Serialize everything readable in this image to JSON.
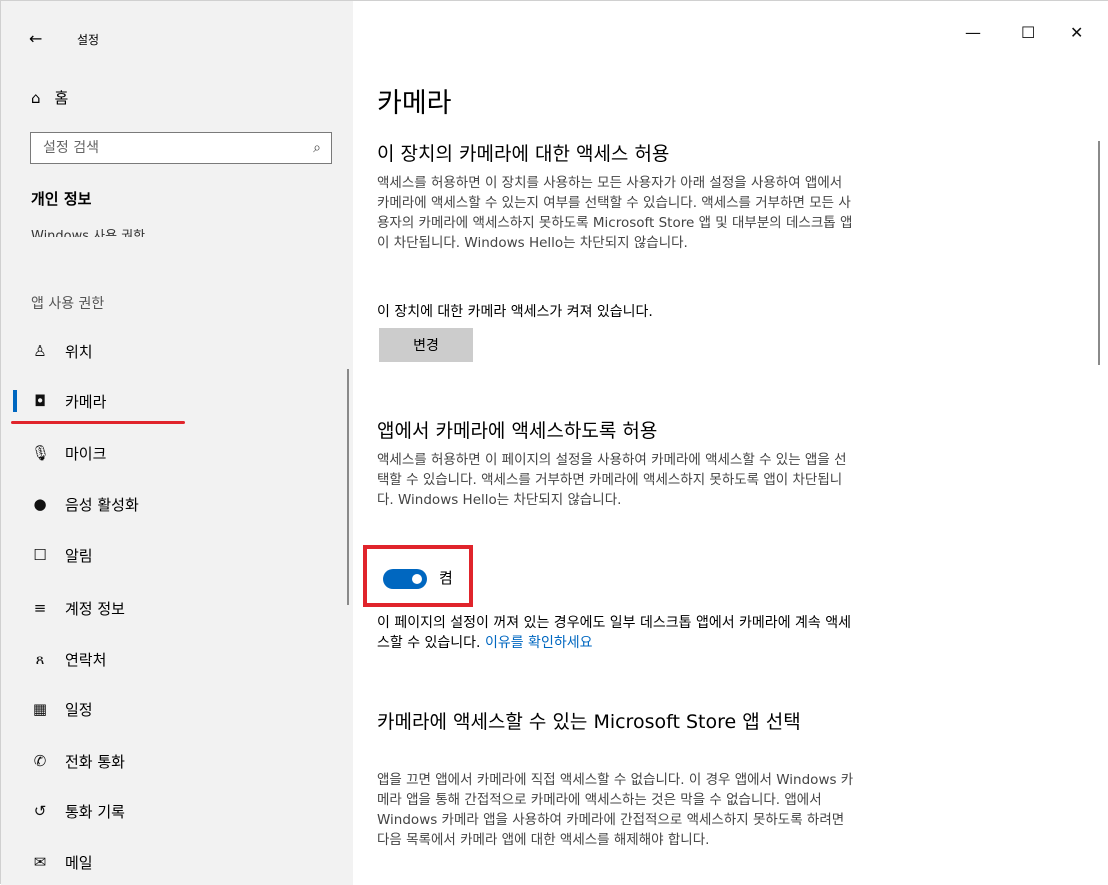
{
  "window": {
    "title": "설정",
    "back_glyph": "←",
    "minimize_glyph": "—",
    "maximize_glyph": "☐",
    "close_glyph": "✕"
  },
  "sidebar": {
    "home_icon": "⌂",
    "home_label": "홈",
    "search_placeholder": "설정 검색",
    "search_icon": "⌕",
    "section_title": "개인 정보",
    "clipped_item": "Windows 사용 권한",
    "group_label": "앱 사용 권한",
    "items": [
      {
        "icon": "♙",
        "label": "위치"
      },
      {
        "icon": "◘",
        "label": "카메라",
        "active": true
      },
      {
        "icon": "🎙",
        "label": "마이크"
      },
      {
        "icon": "●",
        "label": "음성 활성화"
      },
      {
        "icon": "☐",
        "label": "알림"
      },
      {
        "icon": "≡",
        "label": "계정 정보"
      },
      {
        "icon": "ጸ",
        "label": "연락처"
      },
      {
        "icon": "▦",
        "label": "일정"
      },
      {
        "icon": "✆",
        "label": "전화 통화"
      },
      {
        "icon": "↺",
        "label": "통화 기록"
      },
      {
        "icon": "✉",
        "label": "메일"
      }
    ]
  },
  "content": {
    "page_title": "카메라",
    "section1": {
      "heading": "이 장치의 카메라에 대한 액세스 허용",
      "description": "액세스를 허용하면 이 장치를 사용하는 모든 사용자가 아래 설정을 사용하여 앱에서 카메라에 액세스할 수 있는지 여부를 선택할 수 있습니다. 액세스를 거부하면 모든 사용자의 카메라에 액세스하지 못하도록 Microsoft Store 앱 및 대부분의 데스크톱 앱이 차단됩니다. Windows Hello는 차단되지 않습니다.",
      "status": "이 장치에 대한 카메라 액세스가 켜져 있습니다.",
      "button": "변경"
    },
    "section2": {
      "heading": "앱에서 카메라에 액세스하도록 허용",
      "description": "액세스를 허용하면 이 페이지의 설정을 사용하여 카메라에 액세스할 수 있는 앱을 선택할 수 있습니다. 액세스를 거부하면 카메라에 액세스하지 못하도록 앱이 차단됩니다. Windows Hello는 차단되지 않습니다.",
      "toggle_state": "켬",
      "toggle_on": true,
      "note": "이 페이지의 설정이 꺼져 있는 경우에도 일부 데스크톱 앱에서 카메라에 계속 액세스할 수 있습니다.",
      "note_link": "이유를 확인하세요"
    },
    "section3": {
      "heading": "카메라에 액세스할 수 있는 Microsoft Store 앱 선택",
      "description": "앱을 끄면 앱에서 카메라에 직접 액세스할 수 없습니다. 이 경우 앱에서 Windows 카메라 앱을 통해 간접적으로 카메라에 액세스하는 것은 막을 수 없습니다. 앱에서 Windows 카메라 앱을 사용하여 카메라에 간접적으로 액세스하지 못하도록 하려면 다음 목록에서 카메라 앱에 대한 액세스를 해제해야 합니다."
    }
  },
  "colors": {
    "accent": "#0067c0",
    "highlight_red": "#e0242b",
    "sidebar_bg": "#f2f2f2"
  }
}
